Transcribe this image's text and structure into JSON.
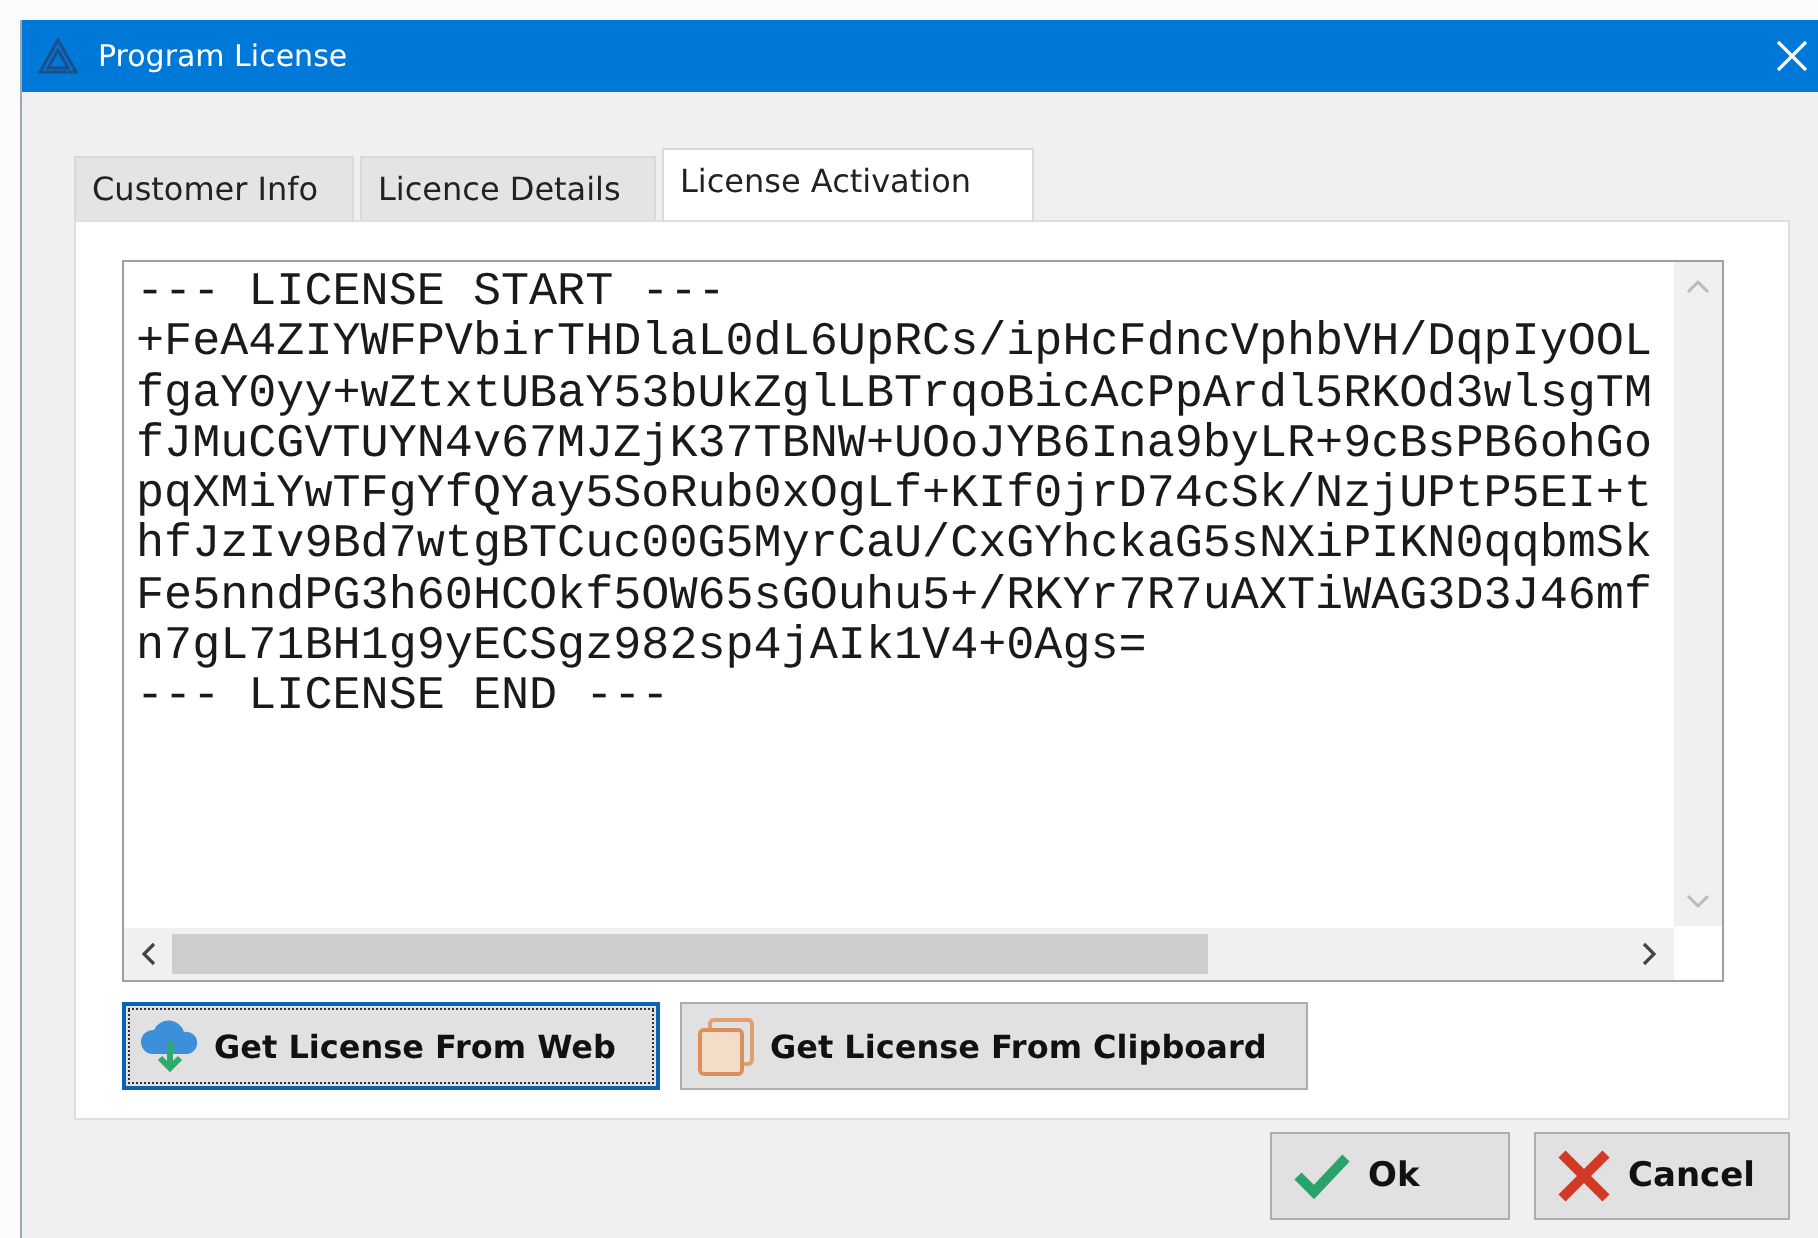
{
  "window": {
    "title": "Program License"
  },
  "tabs": [
    {
      "label": "Customer Info",
      "selected": false
    },
    {
      "label": "Licence Details",
      "selected": false
    },
    {
      "label": "License Activation",
      "selected": true
    }
  ],
  "license_text": {
    "lines": [
      "--- LICENSE START ---",
      "+FeA4ZIYWFPVbirTHDlaL0dL6UpRCs/ipHcFdncVphbVH/DqpIyOOL",
      "fgaY0yy+wZtxtUBaY53bUkZglLBTrqoBicAcPpArdl5RKOd3wlsgTM",
      "fJMuCGVTUYN4v67MJZjK37TBNW+UOoJYB6Ina9byLR+9cBsPB6ohGo",
      "pqXMiYwTFgYfQYay5SoRub0xOgLf+KIf0jrD74cSk/NzjUPtP5EI+t",
      "hfJzIv9Bd7wtgBTCuc00G5MyrCaU/CxGYhckaG5sNXiPIKN0qqbmSk",
      "Fe5nndPG3h60HCOkf5OW65sGOuhu5+/RKYr7R7uAXTiWAG3D3J46mf",
      "n7gL71BH1g9yECSgz982sp4jAIk1V4+0Ags=",
      "--- LICENSE END ---"
    ]
  },
  "actions": [
    {
      "label": "Get License From Web",
      "kind": "web",
      "focused": true
    },
    {
      "label": "Get License From Clipboard",
      "kind": "clipboard",
      "focused": false
    }
  ],
  "dialog_buttons": [
    {
      "label": "Ok",
      "kind": "ok"
    },
    {
      "label": "Cancel",
      "kind": "cancel"
    }
  ]
}
